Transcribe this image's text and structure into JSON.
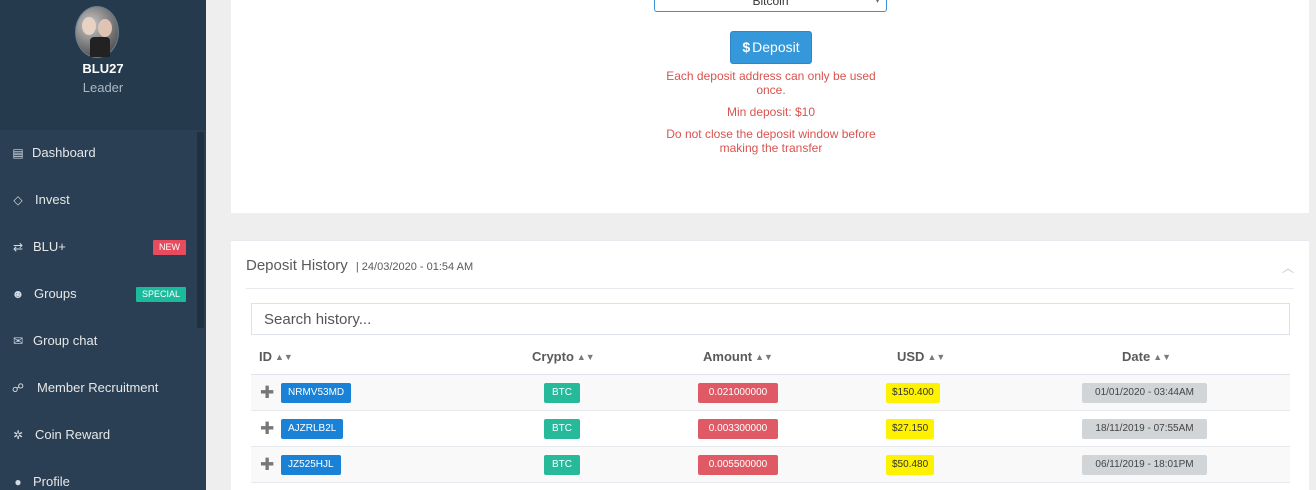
{
  "sidebar": {
    "profile": {
      "username": "BLU27",
      "role": "Leader"
    },
    "items": [
      {
        "label": "Dashboard",
        "icon": "dashboard-icon",
        "glyph": "▤",
        "badge": ""
      },
      {
        "label": "Invest",
        "icon": "diamond-icon",
        "glyph": "◇",
        "badge": ""
      },
      {
        "label": "BLU+",
        "icon": "exchange-icon",
        "glyph": "⇄",
        "badge": "NEW"
      },
      {
        "label": "Groups",
        "icon": "users-icon",
        "glyph": "☻",
        "badge": "SPECIAL"
      },
      {
        "label": "Group chat",
        "icon": "comments-icon",
        "glyph": "✉",
        "badge": ""
      },
      {
        "label": "Member Recruitment",
        "icon": "handshake-icon",
        "glyph": "☍",
        "badge": ""
      },
      {
        "label": "Coin Reward",
        "icon": "gear-icon",
        "glyph": "✲",
        "badge": ""
      },
      {
        "label": "Profile",
        "icon": "user-icon",
        "glyph": "●",
        "badge": ""
      }
    ]
  },
  "deposit_form": {
    "selected_crypto": "Bitcoin",
    "button_label": "Deposit",
    "button_symbol": "$",
    "notice_1": "Each deposit address can only be used once.",
    "notice_2": "Min deposit: $10",
    "notice_3": "Do not close the deposit window before making the transfer"
  },
  "history": {
    "title": "Deposit History",
    "separator": "|",
    "datetime": "24/03/2020 - 01:54 AM",
    "search_placeholder": "Search history...",
    "columns": [
      "ID",
      "Crypto",
      "Amount",
      "USD",
      "Date"
    ],
    "rows": [
      {
        "id": "NRMV53MD",
        "crypto": "BTC",
        "amount": "0.021000000",
        "usd": "$150.400",
        "date": "01/01/2020 - 03:44AM"
      },
      {
        "id": "AJZRLB2L",
        "crypto": "BTC",
        "amount": "0.003300000",
        "usd": "$27.150",
        "date": "18/11/2019 - 07:55AM"
      },
      {
        "id": "JZ525HJL",
        "crypto": "BTC",
        "amount": "0.005500000",
        "usd": "$50.480",
        "date": "06/11/2019 - 18:01PM"
      }
    ]
  },
  "colors": {
    "sidebar_bg": "#2a3f54",
    "primary_blue": "#3498db",
    "danger_text": "#d9534f",
    "badge_green": "#26b99a",
    "badge_red": "#e05a66",
    "badge_yellow": "#fff200"
  }
}
